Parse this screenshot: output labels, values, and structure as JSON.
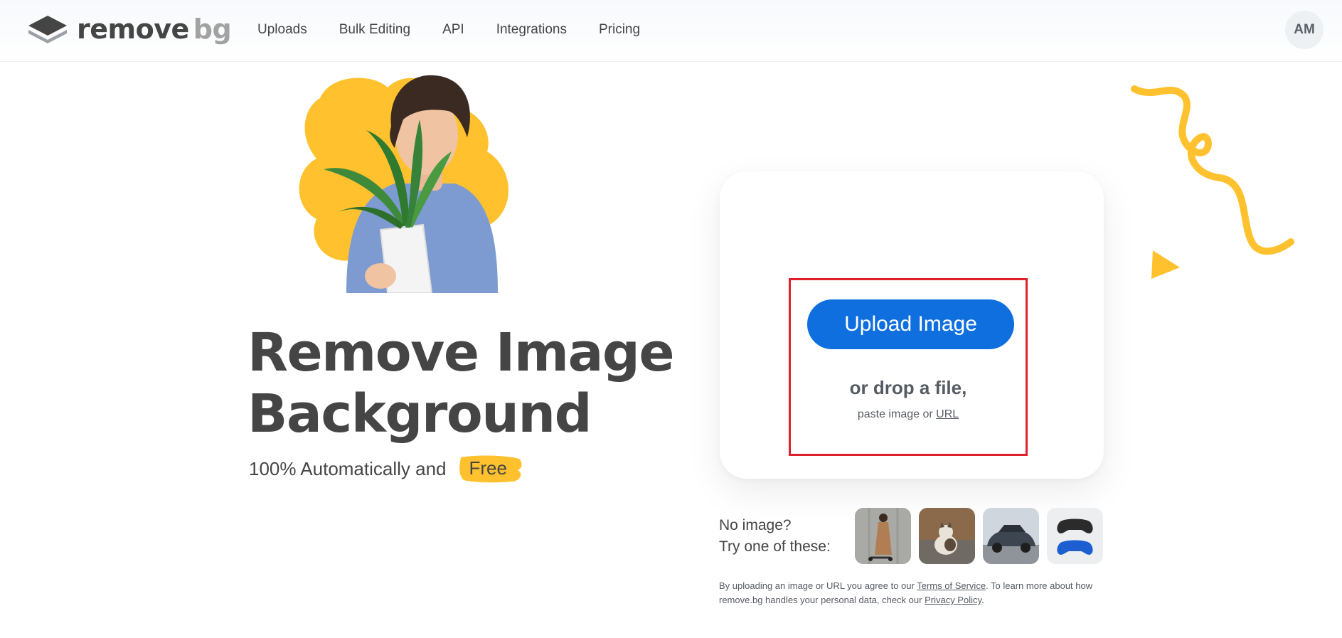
{
  "header": {
    "logo_primary": "remove",
    "logo_secondary": "bg",
    "nav": [
      {
        "label": "Uploads"
      },
      {
        "label": "Bulk Editing"
      },
      {
        "label": "API"
      },
      {
        "label": "Integrations"
      },
      {
        "label": "Pricing"
      }
    ],
    "avatar_initials": "AM"
  },
  "hero": {
    "headline_line1": "Remove Image",
    "headline_line2": "Background",
    "subtitle": "100% Automatically and",
    "free_badge": "Free"
  },
  "upload": {
    "button_label": "Upload Image",
    "drop_text": "or drop a file,",
    "paste_prefix": "paste image or",
    "url_link": "URL"
  },
  "samples": {
    "prompt_line1": "No image?",
    "prompt_line2": "Try one of these:",
    "items": [
      "woman-with-scooter",
      "cat",
      "car",
      "game-controllers"
    ]
  },
  "legal": {
    "text_1": "By uploading an image or URL you agree to our",
    "terms_link": "Terms of Service",
    "text_2": ". To learn more about how remove.bg handles your personal data, check our",
    "privacy_link": "Privacy Policy",
    "text_3": "."
  },
  "colors": {
    "accent": "#0f6fde",
    "yellow": "#ffc22e",
    "highlight_red": "#e0202a",
    "text": "#454545"
  }
}
